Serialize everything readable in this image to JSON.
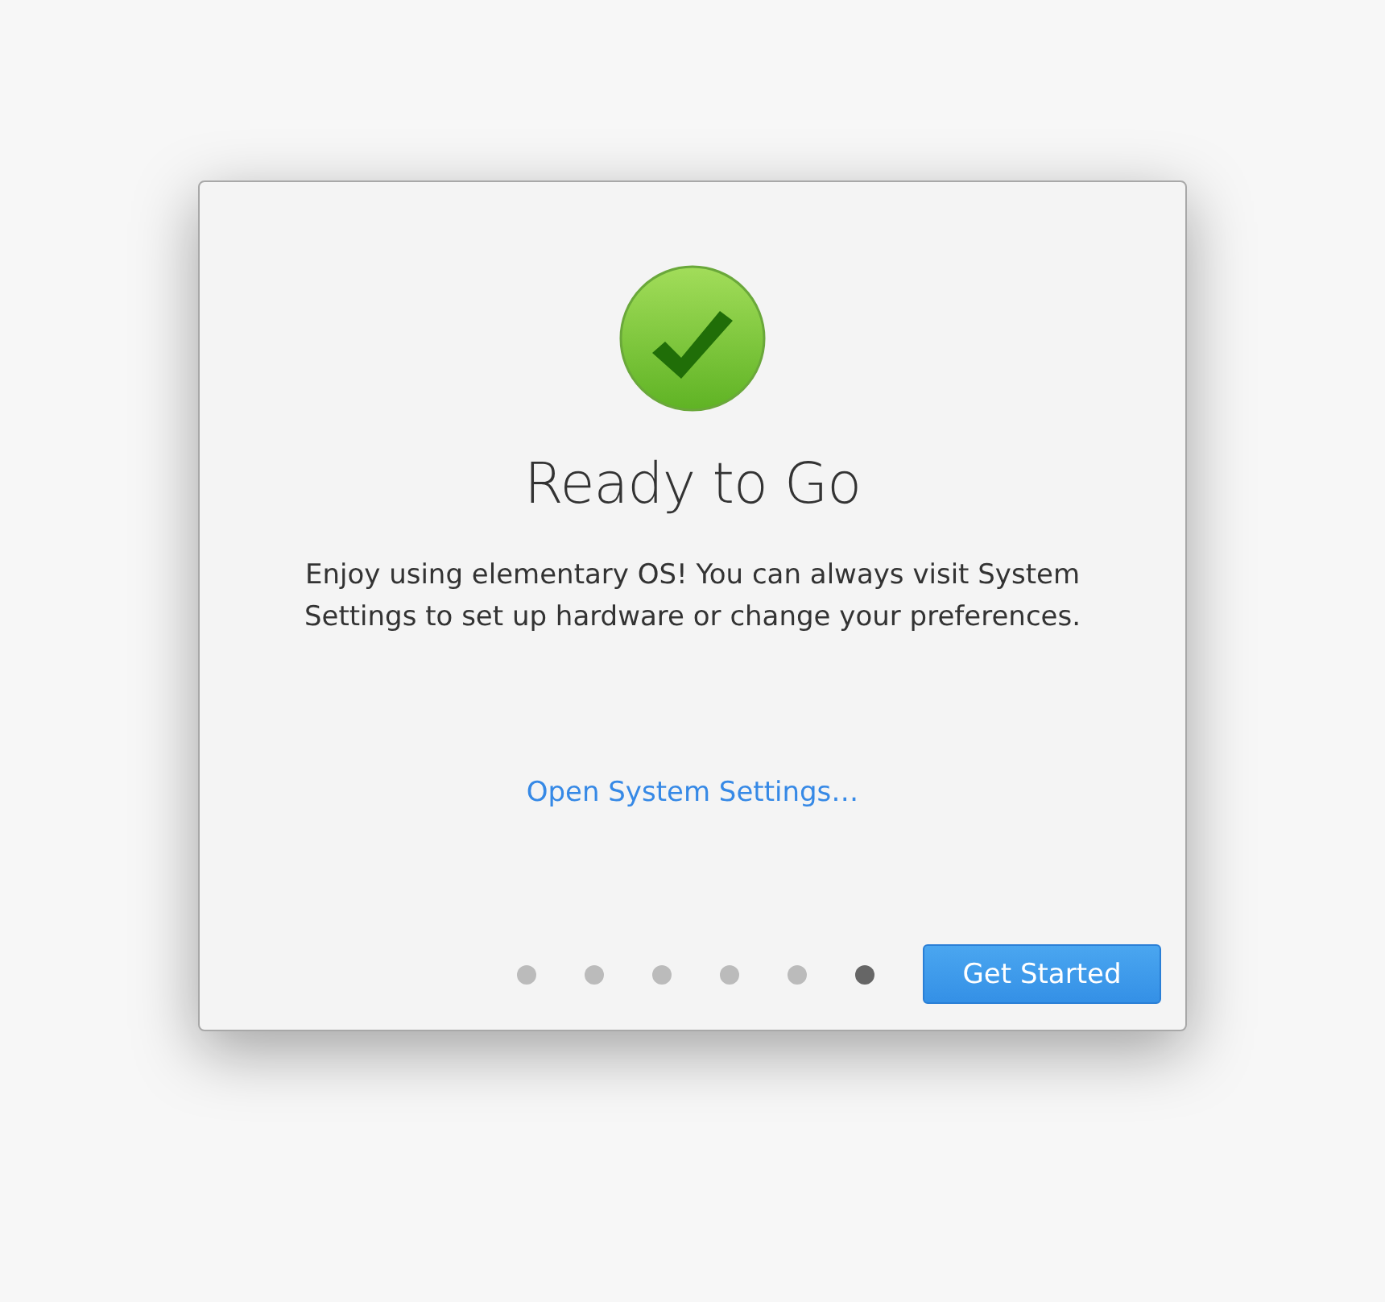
{
  "dialog": {
    "title": "Ready to Go",
    "message": "Enjoy using elementary OS! You can always visit System Settings to set up hardware or change your preferences.",
    "link": "Open System Settings…",
    "pages": [
      {
        "selected": false
      },
      {
        "selected": false
      },
      {
        "selected": false
      },
      {
        "selected": false
      },
      {
        "selected": false
      },
      {
        "selected": true
      }
    ],
    "button": "Get Started"
  }
}
